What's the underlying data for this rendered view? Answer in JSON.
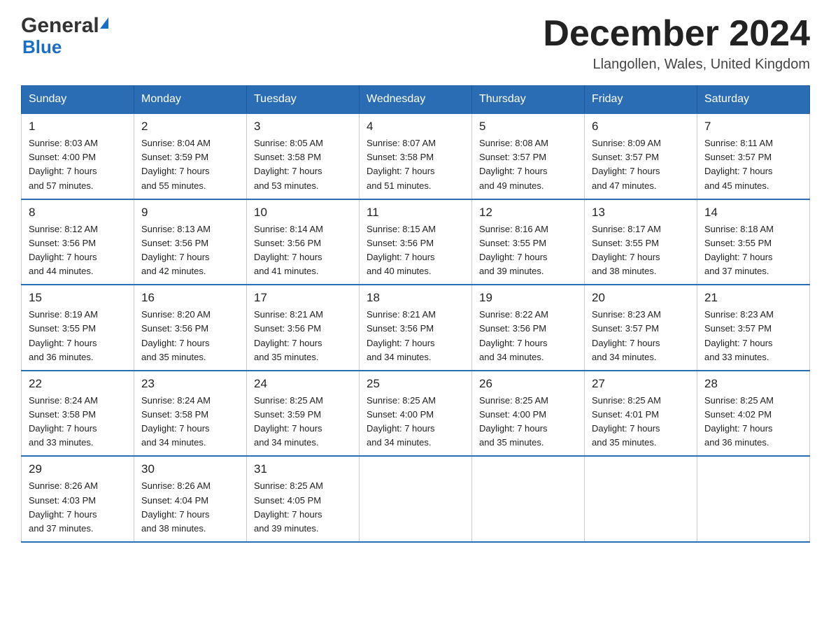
{
  "header": {
    "logo_general": "General",
    "logo_blue": "Blue",
    "month_title": "December 2024",
    "location": "Llangollen, Wales, United Kingdom"
  },
  "days_of_week": [
    "Sunday",
    "Monday",
    "Tuesday",
    "Wednesday",
    "Thursday",
    "Friday",
    "Saturday"
  ],
  "weeks": [
    [
      {
        "day": "1",
        "sunrise": "8:03 AM",
        "sunset": "4:00 PM",
        "daylight": "7 hours and 57 minutes."
      },
      {
        "day": "2",
        "sunrise": "8:04 AM",
        "sunset": "3:59 PM",
        "daylight": "7 hours and 55 minutes."
      },
      {
        "day": "3",
        "sunrise": "8:05 AM",
        "sunset": "3:58 PM",
        "daylight": "7 hours and 53 minutes."
      },
      {
        "day": "4",
        "sunrise": "8:07 AM",
        "sunset": "3:58 PM",
        "daylight": "7 hours and 51 minutes."
      },
      {
        "day": "5",
        "sunrise": "8:08 AM",
        "sunset": "3:57 PM",
        "daylight": "7 hours and 49 minutes."
      },
      {
        "day": "6",
        "sunrise": "8:09 AM",
        "sunset": "3:57 PM",
        "daylight": "7 hours and 47 minutes."
      },
      {
        "day": "7",
        "sunrise": "8:11 AM",
        "sunset": "3:57 PM",
        "daylight": "7 hours and 45 minutes."
      }
    ],
    [
      {
        "day": "8",
        "sunrise": "8:12 AM",
        "sunset": "3:56 PM",
        "daylight": "7 hours and 44 minutes."
      },
      {
        "day": "9",
        "sunrise": "8:13 AM",
        "sunset": "3:56 PM",
        "daylight": "7 hours and 42 minutes."
      },
      {
        "day": "10",
        "sunrise": "8:14 AM",
        "sunset": "3:56 PM",
        "daylight": "7 hours and 41 minutes."
      },
      {
        "day": "11",
        "sunrise": "8:15 AM",
        "sunset": "3:56 PM",
        "daylight": "7 hours and 40 minutes."
      },
      {
        "day": "12",
        "sunrise": "8:16 AM",
        "sunset": "3:55 PM",
        "daylight": "7 hours and 39 minutes."
      },
      {
        "day": "13",
        "sunrise": "8:17 AM",
        "sunset": "3:55 PM",
        "daylight": "7 hours and 38 minutes."
      },
      {
        "day": "14",
        "sunrise": "8:18 AM",
        "sunset": "3:55 PM",
        "daylight": "7 hours and 37 minutes."
      }
    ],
    [
      {
        "day": "15",
        "sunrise": "8:19 AM",
        "sunset": "3:55 PM",
        "daylight": "7 hours and 36 minutes."
      },
      {
        "day": "16",
        "sunrise": "8:20 AM",
        "sunset": "3:56 PM",
        "daylight": "7 hours and 35 minutes."
      },
      {
        "day": "17",
        "sunrise": "8:21 AM",
        "sunset": "3:56 PM",
        "daylight": "7 hours and 35 minutes."
      },
      {
        "day": "18",
        "sunrise": "8:21 AM",
        "sunset": "3:56 PM",
        "daylight": "7 hours and 34 minutes."
      },
      {
        "day": "19",
        "sunrise": "8:22 AM",
        "sunset": "3:56 PM",
        "daylight": "7 hours and 34 minutes."
      },
      {
        "day": "20",
        "sunrise": "8:23 AM",
        "sunset": "3:57 PM",
        "daylight": "7 hours and 34 minutes."
      },
      {
        "day": "21",
        "sunrise": "8:23 AM",
        "sunset": "3:57 PM",
        "daylight": "7 hours and 33 minutes."
      }
    ],
    [
      {
        "day": "22",
        "sunrise": "8:24 AM",
        "sunset": "3:58 PM",
        "daylight": "7 hours and 33 minutes."
      },
      {
        "day": "23",
        "sunrise": "8:24 AM",
        "sunset": "3:58 PM",
        "daylight": "7 hours and 34 minutes."
      },
      {
        "day": "24",
        "sunrise": "8:25 AM",
        "sunset": "3:59 PM",
        "daylight": "7 hours and 34 minutes."
      },
      {
        "day": "25",
        "sunrise": "8:25 AM",
        "sunset": "4:00 PM",
        "daylight": "7 hours and 34 minutes."
      },
      {
        "day": "26",
        "sunrise": "8:25 AM",
        "sunset": "4:00 PM",
        "daylight": "7 hours and 35 minutes."
      },
      {
        "day": "27",
        "sunrise": "8:25 AM",
        "sunset": "4:01 PM",
        "daylight": "7 hours and 35 minutes."
      },
      {
        "day": "28",
        "sunrise": "8:25 AM",
        "sunset": "4:02 PM",
        "daylight": "7 hours and 36 minutes."
      }
    ],
    [
      {
        "day": "29",
        "sunrise": "8:26 AM",
        "sunset": "4:03 PM",
        "daylight": "7 hours and 37 minutes."
      },
      {
        "day": "30",
        "sunrise": "8:26 AM",
        "sunset": "4:04 PM",
        "daylight": "7 hours and 38 minutes."
      },
      {
        "day": "31",
        "sunrise": "8:25 AM",
        "sunset": "4:05 PM",
        "daylight": "7 hours and 39 minutes."
      },
      null,
      null,
      null,
      null
    ]
  ],
  "labels": {
    "sunrise": "Sunrise:",
    "sunset": "Sunset:",
    "daylight": "Daylight:"
  }
}
